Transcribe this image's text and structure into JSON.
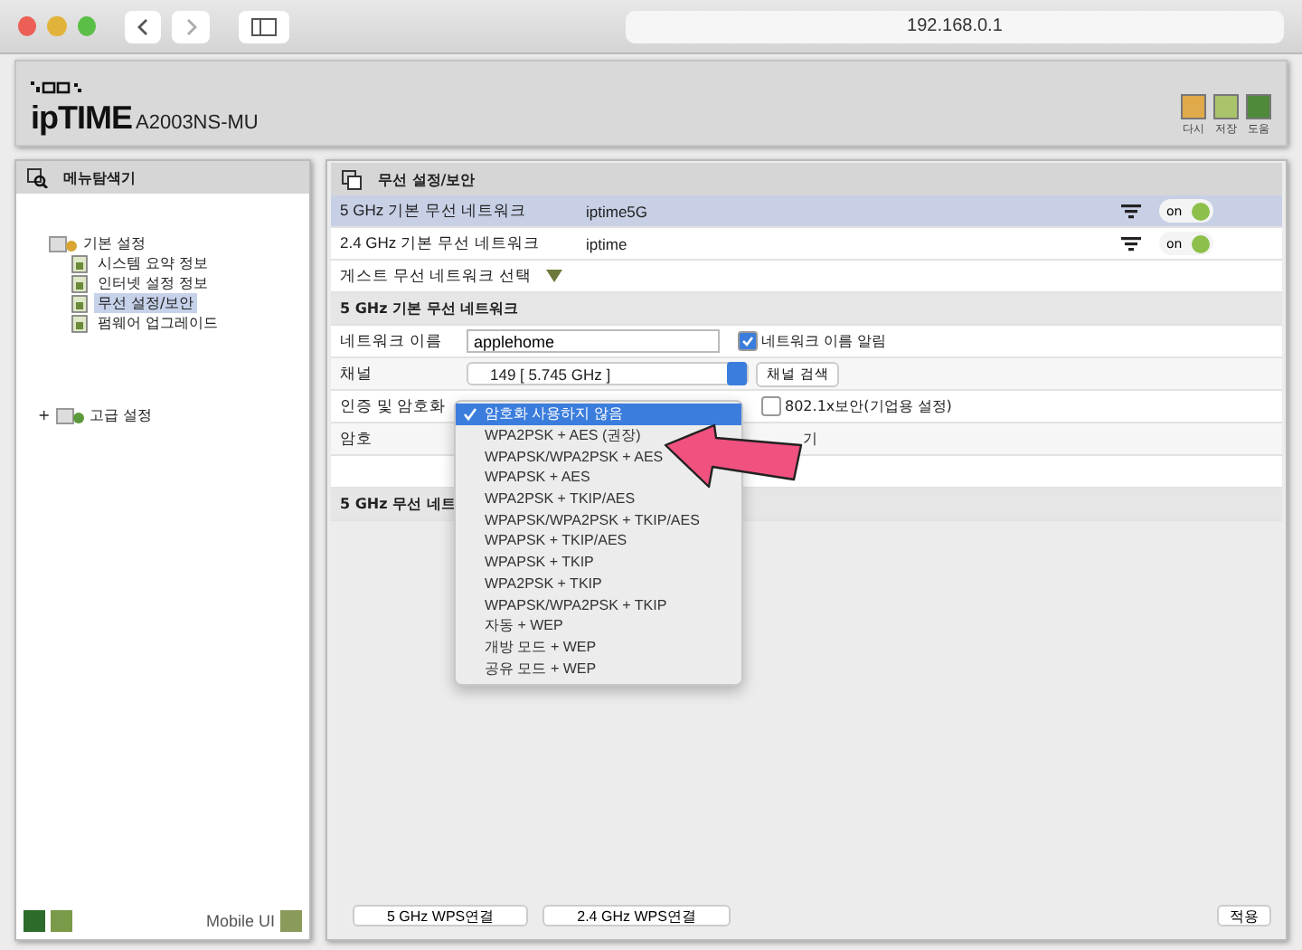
{
  "browser": {
    "url": "192.168.0.1"
  },
  "header": {
    "brand": "ipTIME",
    "model": "A2003NS-MU",
    "actions": [
      {
        "label": "다시",
        "color": "#e0a94a"
      },
      {
        "label": "저장",
        "color": "#a9c46a"
      },
      {
        "label": "도움",
        "color": "#4f8a3a"
      }
    ]
  },
  "sidebar": {
    "title": "메뉴탐색기",
    "tree": [
      {
        "label": "기본 설정",
        "children": [
          {
            "label": "시스템 요약 정보",
            "selected": false
          },
          {
            "label": "인터넷 설정 정보",
            "selected": false
          },
          {
            "label": "무선 설정/보안",
            "selected": true
          },
          {
            "label": "펌웨어 업그레이드",
            "selected": false
          }
        ]
      },
      {
        "label": "고급 설정",
        "marker": "+"
      }
    ],
    "mobile_label": "Mobile UI"
  },
  "main": {
    "title": "무선 설정/보안",
    "networks": [
      {
        "band": "5 GHz 기본 무선 네트워크",
        "ssid": "iptime5G",
        "toggle": "on",
        "on": true,
        "selected": true
      },
      {
        "band": "2.4 GHz 기본 무선 네트워크",
        "ssid": "iptime",
        "toggle": "on",
        "on": true,
        "selected": false
      }
    ],
    "guest_label": "게스트 무선 네트워크 선택",
    "section_title": "5 GHz 기본 무선 네트워크",
    "network_name_label": "네트워크 이름",
    "network_name": "applehome",
    "broadcast": {
      "label": "네트워크 이름 알림",
      "checked": true
    },
    "channel_label": "채널",
    "channel_value": "149 [ 5.745 GHz ]",
    "channel_scan": "채널 검색",
    "auth_label": "인증 및 암호화",
    "dot1x": {
      "label": "802.1x보안(기업용 설정)",
      "checked": false
    },
    "password_label": "암호",
    "password_show": "기",
    "section2_title": "5 GHz 무선 네트",
    "wps_buttons": [
      "5 GHz WPS연결",
      "2.4 GHz WPS연결"
    ],
    "apply": "적용"
  },
  "dropdown": {
    "options": [
      {
        "label": "암호화 사용하지 않음",
        "selected": true
      },
      {
        "label": "WPA2PSK + AES (권장)",
        "selected": false
      },
      {
        "label": "WPAPSK/WPA2PSK + AES",
        "selected": false
      },
      {
        "label": "WPAPSK + AES",
        "selected": false
      },
      {
        "label": "WPA2PSK + TKIP/AES",
        "selected": false
      },
      {
        "label": "WPAPSK/WPA2PSK + TKIP/AES",
        "selected": false
      },
      {
        "label": "WPAPSK + TKIP/AES",
        "selected": false
      },
      {
        "label": "WPAPSK + TKIP",
        "selected": false
      },
      {
        "label": "WPA2PSK + TKIP",
        "selected": false
      },
      {
        "label": "WPAPSK/WPA2PSK + TKIP",
        "selected": false
      },
      {
        "label": "자동 + WEP",
        "selected": false
      },
      {
        "label": "개방 모드 + WEP",
        "selected": false
      },
      {
        "label": "공유 모드 + WEP",
        "selected": false
      }
    ]
  }
}
